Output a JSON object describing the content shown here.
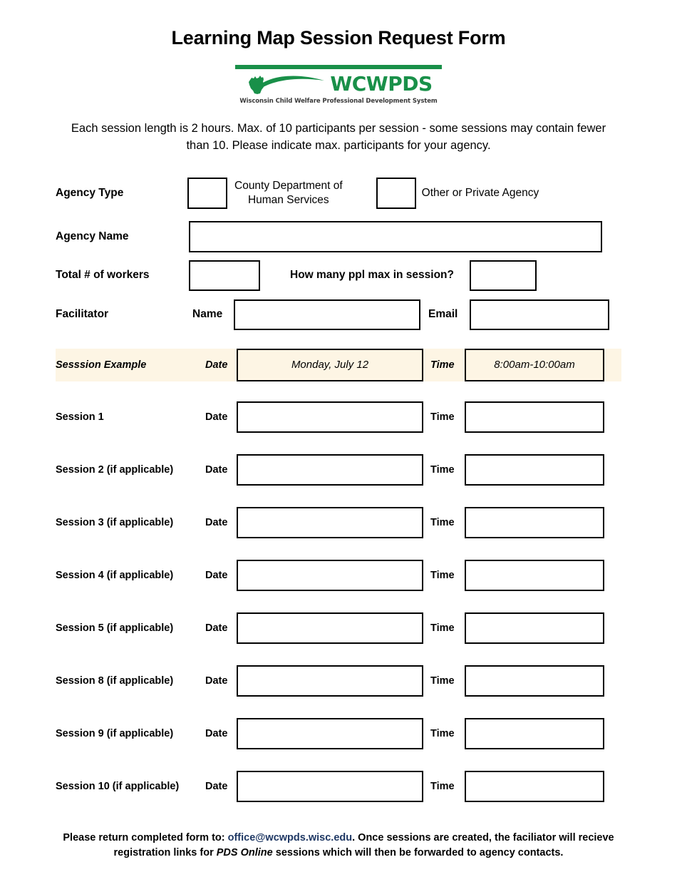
{
  "document": {
    "title": "Learning Map Session Request Form"
  },
  "logo": {
    "wordmark": "WCWPDS",
    "tagline": "Wisconsin Child Welfare Professional Development System",
    "mark_name": "wisconsin-state-swoosh-logo",
    "green": "#199049"
  },
  "intro": {
    "line1": "Each session length is 2 hours. Max. of 10 participants per session - some sessions may contain",
    "line2": "fewer than 10. Please indicate max. participants for your agency.",
    "full": "Each session length is 2 hours. Max. of 10 participants per session - some sessions may contain fewer than 10. Please indicate max. participants for your agency."
  },
  "form": {
    "agency_type": {
      "label": "Agency Type",
      "option1": "County Department of\nHuman Services",
      "option1_line1": "County Department of",
      "option1_line2": "Human Services",
      "option1_checked": false,
      "option2": "Other or Private Agency",
      "option2_checked": false
    },
    "agency_name": {
      "label": "Agency Name",
      "value": ""
    },
    "total_workers": {
      "label": "Total # of workers",
      "value": ""
    },
    "max_in_session": {
      "label": "How many ppl max in session?",
      "value": ""
    },
    "facilitator": {
      "label": "Facilitator",
      "name_label": "Name",
      "name_value": "",
      "email_label": "Email",
      "email_value": ""
    }
  },
  "sessions": {
    "date_label": "Date",
    "time_label": "Time",
    "example": {
      "label": "Sesssion Example",
      "date_label": "Date",
      "date_value": "Monday, July 12",
      "time_label": "Time",
      "time_value": "8:00am-10:00am",
      "highlight_color": "#FDF5E4"
    },
    "rows": [
      {
        "label": "Session 1",
        "date_label": "Date",
        "date_value": "",
        "time_label": "Time",
        "time_value": ""
      },
      {
        "label": "Session 2 (if applicable)",
        "date_label": "Date",
        "date_value": "",
        "time_label": "Time",
        "time_value": ""
      },
      {
        "label": "Session 3 (if applicable)",
        "date_label": "Date",
        "date_value": "",
        "time_label": "Time",
        "time_value": ""
      },
      {
        "label": "Session 4 (if applicable)",
        "date_label": "Date",
        "date_value": "",
        "time_label": "Time",
        "time_value": ""
      },
      {
        "label": "Session 5 (if applicable)",
        "date_label": "Date",
        "date_value": "",
        "time_label": "Time",
        "time_value": ""
      },
      {
        "label": "Session 8 (if applicable)",
        "date_label": "Date",
        "date_value": "",
        "time_label": "Time",
        "time_value": ""
      },
      {
        "label": "Session 9 (if applicable)",
        "date_label": "Date",
        "date_value": "",
        "time_label": "Time",
        "time_value": ""
      },
      {
        "label": "Session 10 (if applicable)",
        "date_label": "Date",
        "date_value": "",
        "time_label": "Time",
        "time_value": ""
      }
    ]
  },
  "footer": {
    "part1": "Please return completed form to: ",
    "email": "office@wcwpds.wisc.edu",
    "part2": ". Once sessions are created, the faciliator will recieve registration links for ",
    "italic": "PDS Online",
    "part3": " sessions which will then be forwarded to  agency contacts.",
    "email_color": "#1F3864"
  }
}
